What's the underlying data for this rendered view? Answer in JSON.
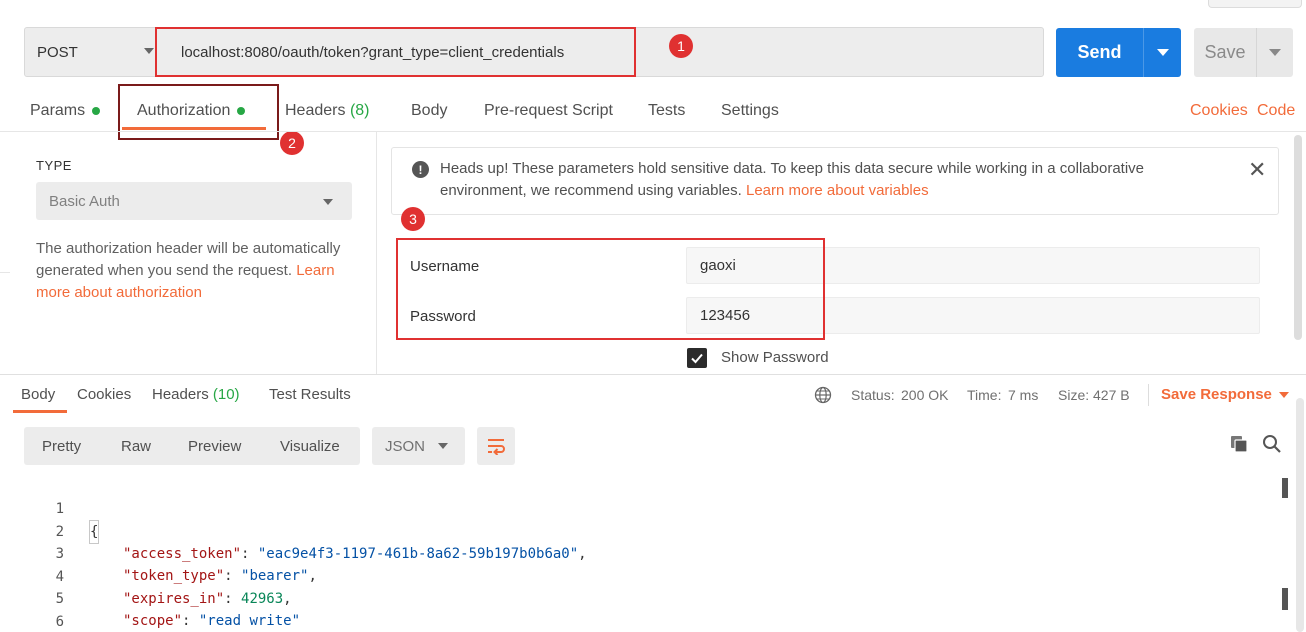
{
  "request": {
    "method": "POST",
    "url": "localhost:8080/oauth/token?grant_type=client_credentials",
    "send_label": "Send",
    "save_label": "Save"
  },
  "annotations": [
    "1",
    "2",
    "3"
  ],
  "tabs": [
    {
      "label": "Params",
      "dot": true
    },
    {
      "label": "Authorization",
      "dot": true,
      "active": true
    },
    {
      "label": "Headers",
      "count": "(8)"
    },
    {
      "label": "Body"
    },
    {
      "label": "Pre-request Script"
    },
    {
      "label": "Tests"
    },
    {
      "label": "Settings"
    }
  ],
  "tab_links": {
    "cookies": "Cookies",
    "code": "Code"
  },
  "auth": {
    "type_label": "TYPE",
    "type_value": "Basic Auth",
    "desc_text": "The authorization header will be automatically generated when you send the request.",
    "desc_link": "Learn more about authorization",
    "notice_text": "Heads up! These parameters hold sensitive data. To keep this data secure while working in a collaborative environment, we recommend using variables.",
    "notice_link": "Learn more about variables",
    "username_label": "Username",
    "username_value": "gaoxi",
    "password_label": "Password",
    "password_value": "123456",
    "show_password_label": "Show Password"
  },
  "response": {
    "tabs": [
      {
        "label": "Body",
        "active": true
      },
      {
        "label": "Cookies"
      },
      {
        "label": "Headers",
        "count": "(10)"
      },
      {
        "label": "Test Results"
      }
    ],
    "status_label": "Status:",
    "status_value": "200 OK",
    "time_label": "Time:",
    "time_value": "7 ms",
    "size_label": "Size:",
    "size_value": "427 B",
    "save_response": "Save Response",
    "view_modes": [
      "Pretty",
      "Raw",
      "Preview",
      "Visualize"
    ],
    "format": "JSON",
    "code": {
      "line_numbers": [
        "1",
        "2",
        "3",
        "4",
        "5",
        "6"
      ],
      "open_brace": "{",
      "close_brace": "}",
      "entries": [
        {
          "key": "\"access_token\"",
          "value": "\"eac9e4f3-1197-461b-8a62-59b197b0b6a0\"",
          "kind": "string",
          "comma": ","
        },
        {
          "key": "\"token_type\"",
          "value": "\"bearer\"",
          "kind": "string",
          "comma": ","
        },
        {
          "key": "\"expires_in\"",
          "value": "42963",
          "kind": "number",
          "comma": ","
        },
        {
          "key": "\"scope\"",
          "value": "\"read write\"",
          "kind": "string",
          "comma": ""
        }
      ]
    }
  },
  "colors": {
    "accent": "#f26b3a",
    "primary": "#1a7ce0",
    "annotation": "#e03131",
    "success": "#27a745"
  }
}
